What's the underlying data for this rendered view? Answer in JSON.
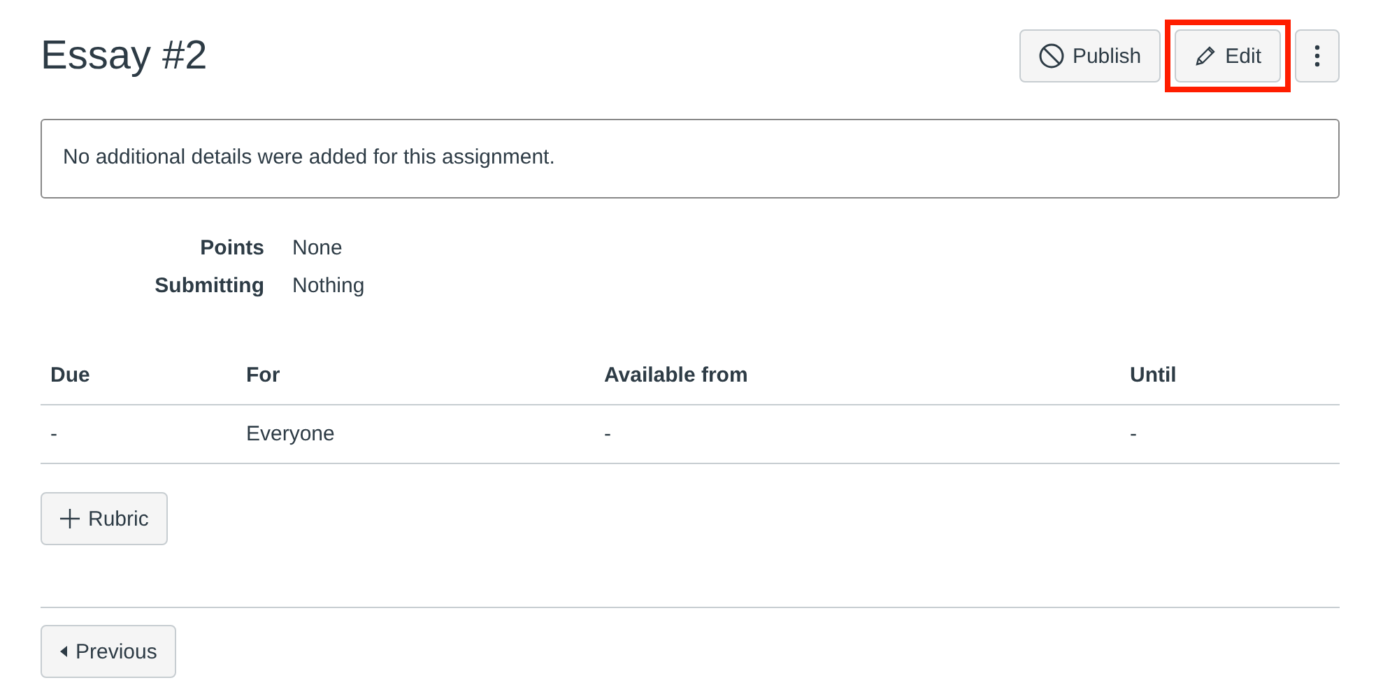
{
  "title": "Essay #2",
  "header_buttons": [
    {
      "kind": "publish",
      "label": "Publish",
      "highlighted": false
    },
    {
      "kind": "edit",
      "label": "Edit",
      "highlighted": true
    },
    {
      "kind": "more",
      "highlighted": false
    }
  ],
  "description": "No additional details were added for this assignment.",
  "details": [
    {
      "label": "Points",
      "value": "None"
    },
    {
      "label": "Submitting",
      "value": "Nothing"
    }
  ],
  "table": {
    "columns": [
      "Due",
      "For",
      "Available from",
      "Until"
    ],
    "rows": [
      [
        "-",
        "Everyone",
        "-",
        "-"
      ]
    ]
  },
  "rubric_button": {
    "label": "Rubric"
  },
  "previous_button": {
    "label": "Previous"
  }
}
